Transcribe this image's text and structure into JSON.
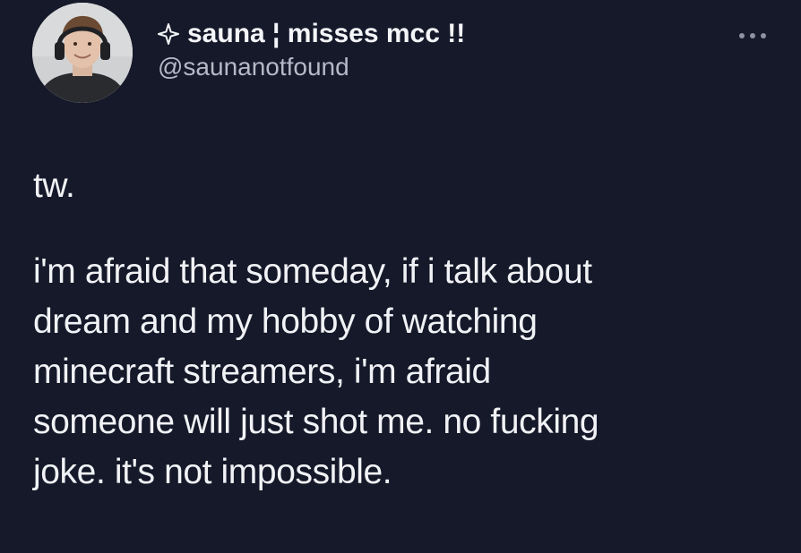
{
  "author": {
    "display_name": "sauna ¦ misses mcc !!",
    "handle": "@saunanotfound",
    "sparkle_icon": "four-point-star-icon",
    "avatar_icon": "profile-photo"
  },
  "more_icon": "more-options-icon",
  "body": {
    "content_warning": "tw.",
    "lines": [
      "i'm afraid that someday, if i talk about",
      "dream and my hobby of watching",
      "minecraft streamers, i'm afraid",
      "someone will just shot me. no fucking",
      "joke. it's not impossible."
    ]
  },
  "colors": {
    "background": "#15192a",
    "text": "#f1f2f5",
    "handle": "#b4bac6"
  }
}
